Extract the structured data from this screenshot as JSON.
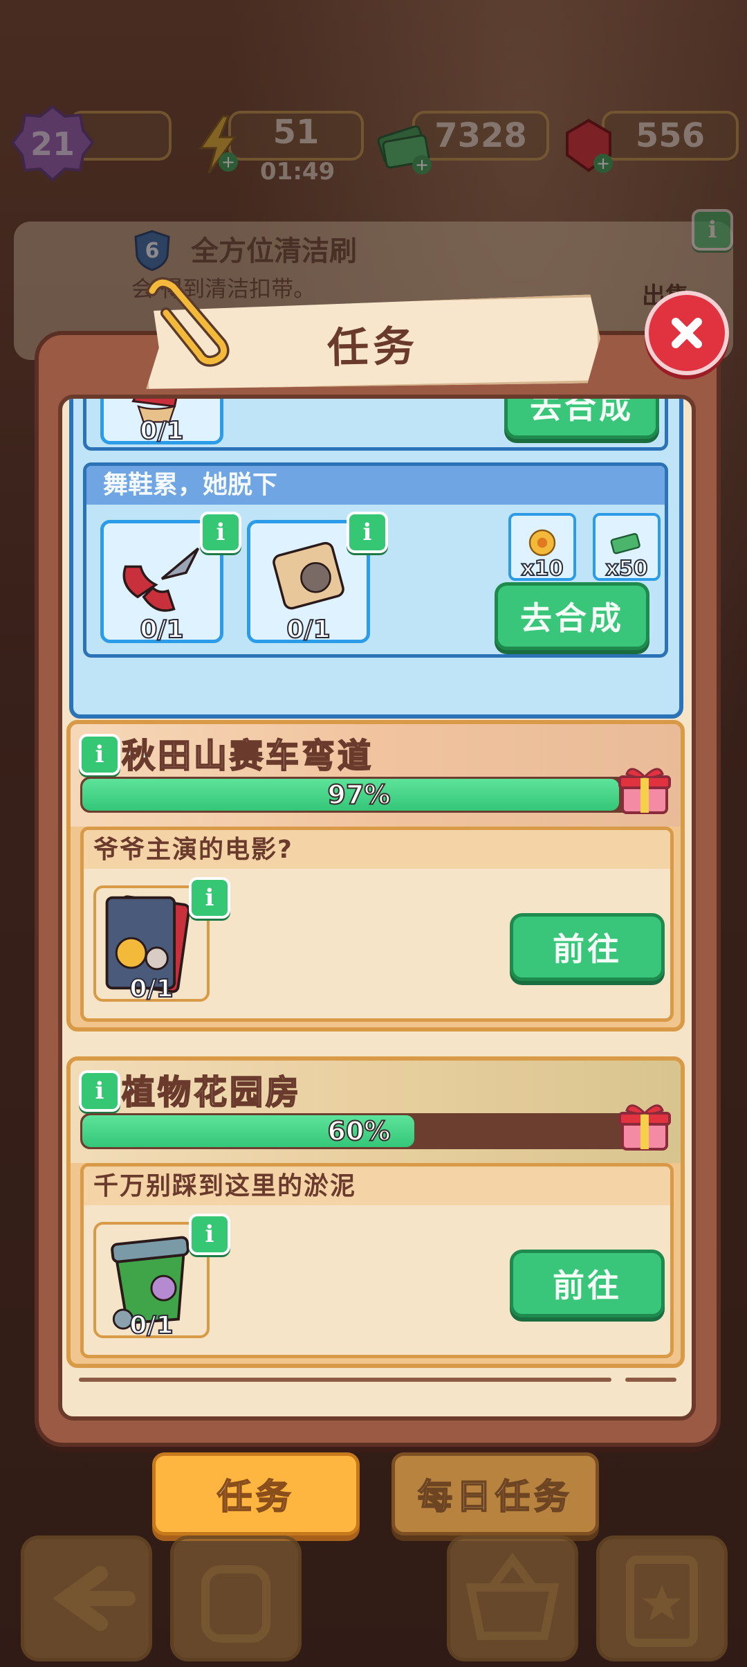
{
  "resources": {
    "level": "21",
    "energy": "51",
    "energy_timer": "01:49",
    "cash": "7328",
    "gems": "556"
  },
  "background_card": {
    "level": "6",
    "title": "全方位清洁刷",
    "subtitle_visible": "会 得到清洁扣带。",
    "right_text": "出售"
  },
  "modal": {
    "title": "任务",
    "close_label": "×"
  },
  "top_task": {
    "count": "0/1",
    "button": "去合成"
  },
  "task_group": {
    "header": "舞鞋累，她脱下",
    "items": [
      {
        "count": "0/1",
        "info": "i"
      },
      {
        "count": "0/1",
        "info": "i"
      }
    ],
    "rewards": [
      {
        "label": "x10",
        "icon": "flower-token-icon"
      },
      {
        "label": "x50",
        "icon": "cash-stack-icon"
      }
    ],
    "button": "去合成"
  },
  "areas": [
    {
      "name": "秋田山赛车弯道",
      "progress": 0.97,
      "progress_text": "97%",
      "task_title": "爷爷主演的电影?",
      "task_count": "0/1",
      "button": "前往",
      "info": "i"
    },
    {
      "name": "植物花园房",
      "progress": 0.6,
      "progress_text": "60%",
      "task_title": "千万别踩到这里的淤泥",
      "task_count": "0/1",
      "button": "前往",
      "info": "i"
    }
  ],
  "tabs": {
    "active": "任务",
    "inactive": "每日任务"
  },
  "colors": {
    "accent_green": "#39c67a",
    "blue_border": "#2c72b6",
    "tab_orange": "#ffb640",
    "close_red": "#e0333f"
  }
}
